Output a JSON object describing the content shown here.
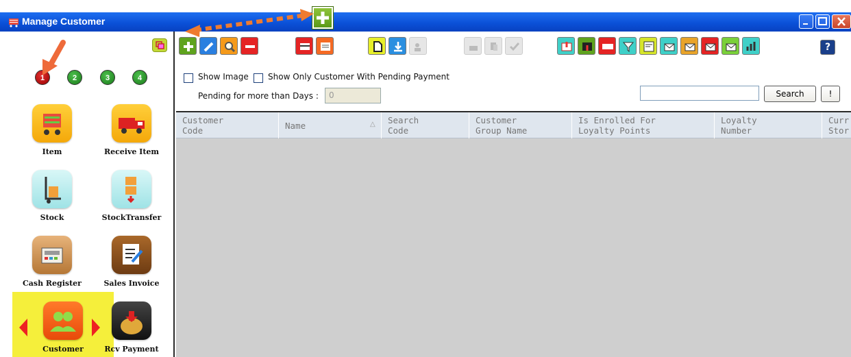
{
  "window": {
    "title": "Manage Customer",
    "colors": {
      "titlebar": "#0a4fd6",
      "accent_arrow": "#ee7b30"
    }
  },
  "sidebar": {
    "pages": [
      "1",
      "2",
      "3",
      "4"
    ],
    "active_page": "1",
    "modules": [
      {
        "label": "Item",
        "icon": "shopping-cart-icon"
      },
      {
        "label": "Receive Item",
        "icon": "delivery-truck-icon"
      },
      {
        "label": "Stock",
        "icon": "hand-truck-icon"
      },
      {
        "label": "StockTransfer",
        "icon": "box-transfer-icon"
      },
      {
        "label": "Cash Register",
        "icon": "cash-register-icon"
      },
      {
        "label": "Sales Invoice",
        "icon": "invoice-pencil-icon"
      },
      {
        "label": "Customer",
        "icon": "customer-group-icon"
      },
      {
        "label": "Rcv Payment",
        "icon": "money-bag-icon"
      }
    ],
    "selected_module": "Customer"
  },
  "toolbar": {
    "buttons": [
      "add-icon",
      "edit-icon",
      "search-icon",
      "delete-icon",
      "card-icon",
      "card-print-icon",
      "new-doc-icon",
      "download-icon",
      "users-disabled-icon",
      "print-disabled-icon",
      "copy-disabled-icon",
      "check-disabled-icon",
      "grid-export-icon",
      "grid-import-icon",
      "calendar-icon",
      "filter-icon",
      "rs-icon",
      "mail-check-icon",
      "mail-icon",
      "mail-red-icon",
      "mail-green-icon",
      "chart-icon",
      "help-icon"
    ],
    "help_label": "?"
  },
  "filters": {
    "show_image": "Show Image",
    "show_pending": "Show Only Customer With Pending Payment",
    "pending_days_label": "Pending for more than Days :",
    "pending_days_value": "0",
    "search_button": "Search",
    "extra_button": "!"
  },
  "grid": {
    "columns": [
      "Customer\nCode",
      "Name",
      "Search\nCode",
      "Customer\nGroup Name",
      "Is Enrolled For\nLoyalty Points",
      "Loyalty\nNumber",
      "Curr\nStor"
    ],
    "sort_indicator": "△"
  }
}
